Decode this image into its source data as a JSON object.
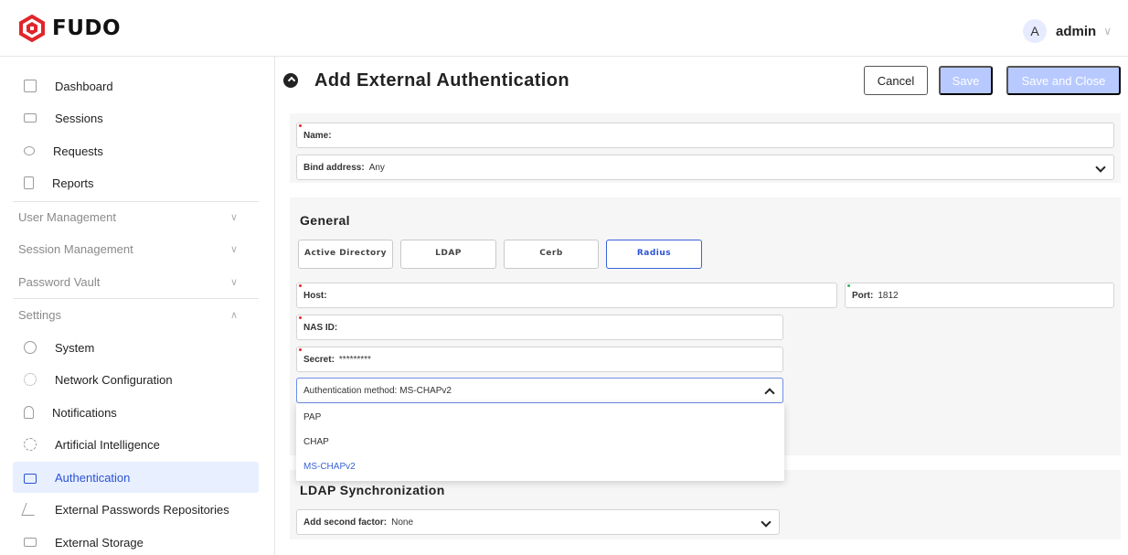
{
  "app": {
    "logo_text": "FUDO",
    "brand_color": "#e0262b"
  },
  "user": {
    "avatar_letter": "A",
    "name": "admin"
  },
  "sidebar": {
    "items": [
      {
        "label": "Dashboard",
        "icon": "dashboard-icon"
      },
      {
        "label": "Sessions",
        "icon": "sessions-icon"
      },
      {
        "label": "Requests",
        "icon": "requests-icon"
      },
      {
        "label": "Reports",
        "icon": "reports-icon"
      }
    ],
    "sections": [
      {
        "label": "User Management"
      },
      {
        "label": "Session Management"
      },
      {
        "label": "Password Vault"
      },
      {
        "label": "Settings"
      }
    ],
    "settings_items": [
      {
        "label": "System",
        "icon": "system-icon"
      },
      {
        "label": "Network Configuration",
        "icon": "network-icon"
      },
      {
        "label": "Notifications",
        "icon": "bell-icon"
      },
      {
        "label": "Artificial Intelligence",
        "icon": "ai-icon"
      },
      {
        "label": "Authentication",
        "icon": "authentication-icon"
      },
      {
        "label": "External Passwords Repositories",
        "icon": "repository-icon"
      },
      {
        "label": "External Storage",
        "icon": "storage-icon"
      }
    ]
  },
  "header": {
    "title": "Add External Authentication",
    "cancel_label": "Cancel",
    "save_label": "Save",
    "save_close_label": "Save and Close"
  },
  "form": {
    "name_label": "Name:",
    "name_value": "",
    "bind_label": "Bind address:",
    "bind_value": "Any",
    "general_title": "General",
    "tabs": [
      {
        "label": "Active Directory",
        "active": false
      },
      {
        "label": "LDAP",
        "active": false
      },
      {
        "label": "Cerb",
        "active": false
      },
      {
        "label": "Radius",
        "active": true
      }
    ],
    "host_label": "Host:",
    "host_value": "",
    "port_label": "Port:",
    "port_value": "1812",
    "nasid_label": "NAS ID:",
    "nasid_value": "",
    "secret_label": "Secret:",
    "secret_value": "*********",
    "auth_method_label": "Authentication method:",
    "auth_method_value": "MS-CHAPv2",
    "auth_method_options": [
      "PAP",
      "CHAP",
      "MS-CHAPv2"
    ],
    "ldap_title": "LDAP Synchronization",
    "second_factor_label": "Add second factor:",
    "second_factor_value": "None"
  },
  "colors": {
    "accent": "#3a63d8",
    "disabled_button": "#b7c9ff",
    "active_nav_bg": "#e8efff",
    "required_marker": "#d93025"
  }
}
